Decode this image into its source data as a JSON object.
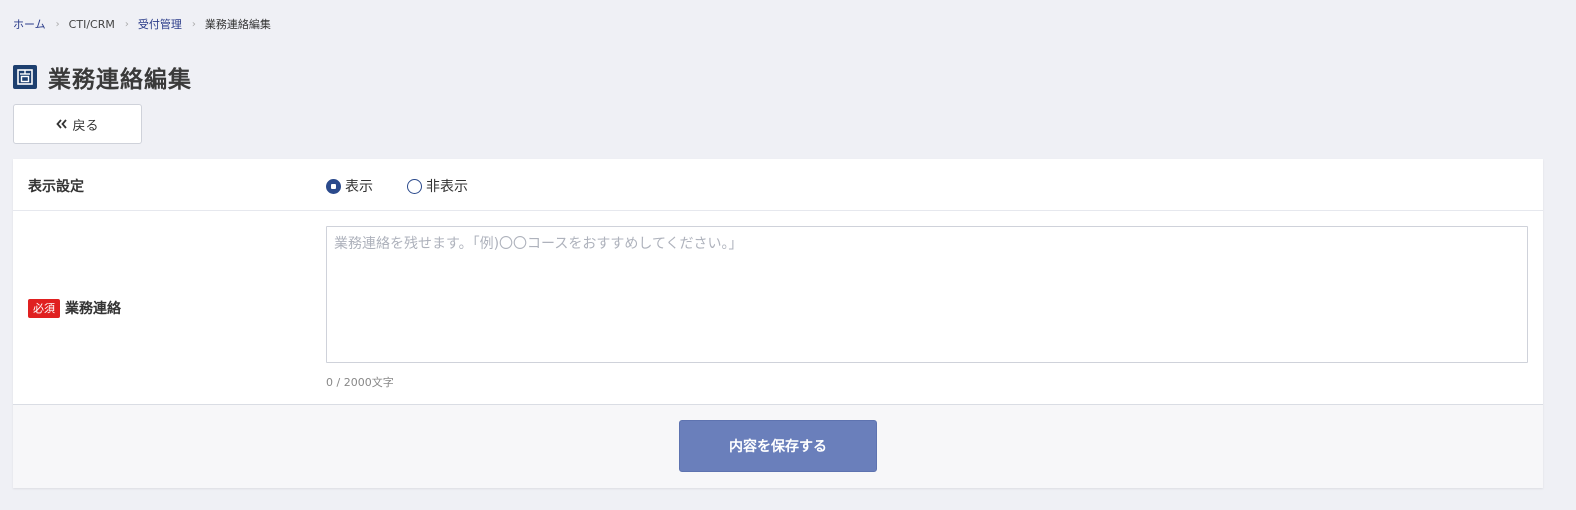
{
  "breadcrumb": {
    "home": "ホーム",
    "cti": "CTI/CRM",
    "reception": "受付管理",
    "current": "業務連絡編集",
    "separator": "›"
  },
  "page": {
    "title": "業務連絡編集",
    "icon": "building-icon"
  },
  "back_button": {
    "label": "戻る",
    "icon": "double-chevron-left-icon"
  },
  "form": {
    "display_setting": {
      "label": "表示設定",
      "options": [
        {
          "label": "表示",
          "checked": true
        },
        {
          "label": "非表示",
          "checked": false
        }
      ]
    },
    "memo": {
      "required_badge": "必須",
      "label": "業務連絡",
      "value": "",
      "placeholder": "業務連絡を残せます。「例)〇〇コースをおすすめしてください。」",
      "char_count": "0 / 2000文字"
    }
  },
  "save_button": {
    "label": "内容を保存する"
  },
  "colors": {
    "background": "#eff0f5",
    "primary": "#2b4a8c",
    "save_button": "#6a7fbb",
    "required": "#e02020",
    "title_icon": "#1d3f6f"
  }
}
